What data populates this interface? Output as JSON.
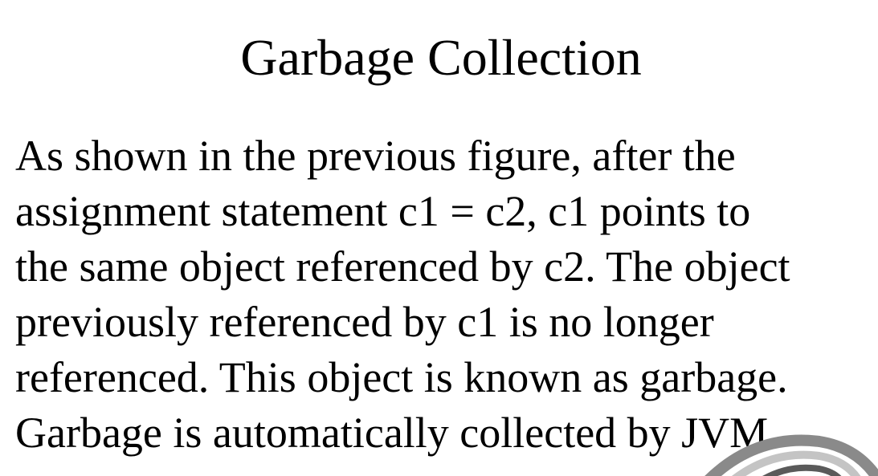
{
  "slide": {
    "title": "Garbage Collection",
    "body_lines": [
      "As shown in the previous figure, after the",
      "assignment statement c1 = c2, c1 points to",
      "the same object referenced by c2. The object",
      "previously referenced by c1 is no longer",
      "referenced. This object is known as garbage.",
      "Garbage is automatically collected by JVM."
    ]
  },
  "decoration": {
    "icon": "swirl-logo-icon",
    "colors": [
      "#8a8a8a",
      "#c4c4c4",
      "#5a5a5a"
    ]
  }
}
